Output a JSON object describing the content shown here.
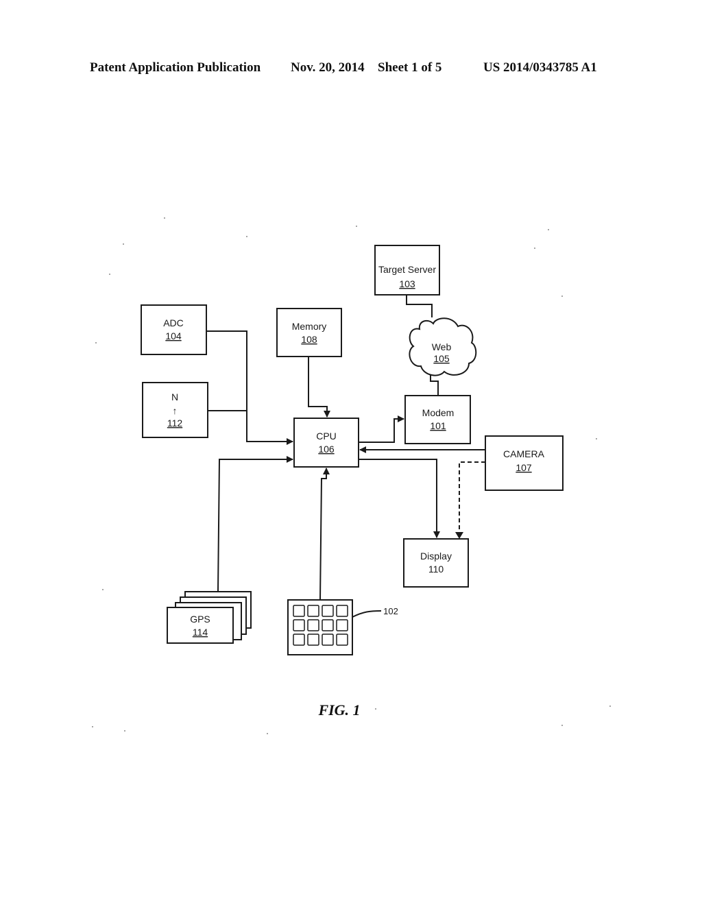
{
  "header": {
    "publication": "Patent Application Publication",
    "date": "Nov. 20, 2014",
    "sheet": "Sheet 1 of 5",
    "number": "US 2014/0343785 A1"
  },
  "blocks": {
    "target_server": {
      "label": "Target Server",
      "ref": "103"
    },
    "web": {
      "label": "Web",
      "ref": "105"
    },
    "adc": {
      "label": "ADC",
      "ref": "104"
    },
    "memory": {
      "label": "Memory",
      "ref": "108"
    },
    "compass": {
      "label": "N",
      "symbol": "↑",
      "ref": "112"
    },
    "modem": {
      "label": "Modem",
      "ref": "101"
    },
    "cpu": {
      "label": "CPU",
      "ref": "106"
    },
    "camera": {
      "label": "CAMERA",
      "ref": "107"
    },
    "display": {
      "label": "Display",
      "ref": "110"
    },
    "gps": {
      "label": "GPS",
      "ref": "114"
    },
    "keypad": {
      "ref": "102"
    }
  },
  "connections": [
    {
      "from": "Target Server",
      "to": "Web",
      "style": "solid",
      "arrow": false
    },
    {
      "from": "Web",
      "to": "Modem",
      "style": "solid",
      "arrow": false
    },
    {
      "from": "CPU",
      "to": "Modem",
      "style": "solid",
      "arrow": true
    },
    {
      "from": "Memory",
      "to": "CPU",
      "style": "solid",
      "arrow": true
    },
    {
      "from": "ADC",
      "to": "CPU",
      "style": "solid",
      "arrow": true
    },
    {
      "from": "N",
      "to": "CPU",
      "style": "solid",
      "arrow": true
    },
    {
      "from": "GPS",
      "to": "CPU",
      "style": "solid",
      "arrow": true
    },
    {
      "from": "Keypad",
      "to": "CPU",
      "style": "solid",
      "arrow": true
    },
    {
      "from": "CAMERA",
      "to": "CPU",
      "style": "solid",
      "arrow": true
    },
    {
      "from": "CPU",
      "to": "Display",
      "style": "solid",
      "arrow": true
    },
    {
      "from": "CAMERA",
      "to": "Display",
      "style": "dashed",
      "arrow": true
    }
  ],
  "figure_caption": "FIG. 1"
}
